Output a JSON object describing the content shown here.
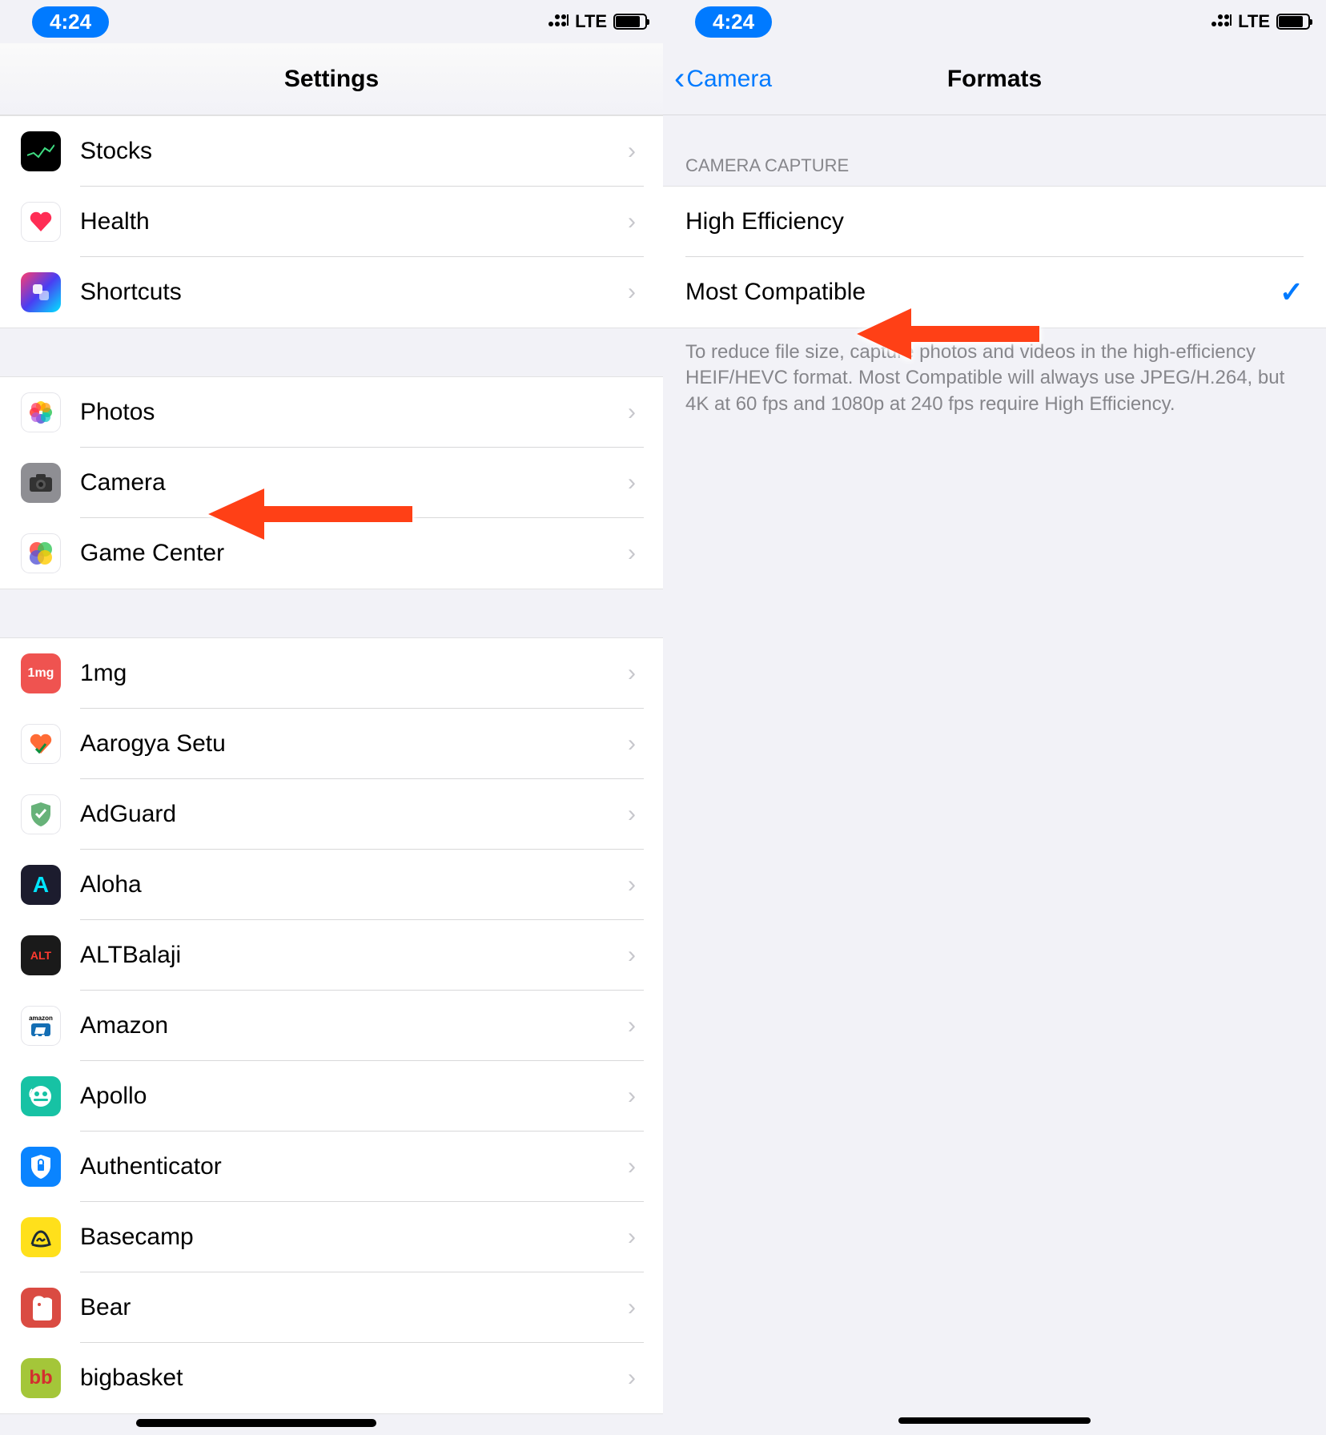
{
  "status": {
    "time": "4:24",
    "carrier": "LTE"
  },
  "left": {
    "title": "Settings",
    "group1": [
      {
        "label": "Stocks",
        "icon": "stocks"
      },
      {
        "label": "Health",
        "icon": "health"
      },
      {
        "label": "Shortcuts",
        "icon": "shortcuts"
      }
    ],
    "group2": [
      {
        "label": "Photos",
        "icon": "photos"
      },
      {
        "label": "Camera",
        "icon": "camera"
      },
      {
        "label": "Game Center",
        "icon": "gamecenter"
      }
    ],
    "group3": [
      {
        "label": "1mg",
        "icon": "1mg"
      },
      {
        "label": "Aarogya Setu",
        "icon": "aarogya"
      },
      {
        "label": "AdGuard",
        "icon": "adguard"
      },
      {
        "label": "Aloha",
        "icon": "aloha"
      },
      {
        "label": "ALTBalaji",
        "icon": "altbalaji"
      },
      {
        "label": "Amazon",
        "icon": "amazon"
      },
      {
        "label": "Apollo",
        "icon": "apollo"
      },
      {
        "label": "Authenticator",
        "icon": "auth"
      },
      {
        "label": "Basecamp",
        "icon": "basecamp"
      },
      {
        "label": "Bear",
        "icon": "bear"
      },
      {
        "label": "bigbasket",
        "icon": "bigbasket"
      }
    ]
  },
  "right": {
    "back_label": "Camera",
    "title": "Formats",
    "section_header": "CAMERA CAPTURE",
    "options": [
      {
        "label": "High Efficiency",
        "selected": false
      },
      {
        "label": "Most Compatible",
        "selected": true
      }
    ],
    "footer": "To reduce file size, capture photos and videos in the high-efficiency HEIF/HEVC format. Most Compatible will always use JPEG/H.264, but 4K at 60 fps and 1080p at 240 fps require High Efficiency."
  }
}
